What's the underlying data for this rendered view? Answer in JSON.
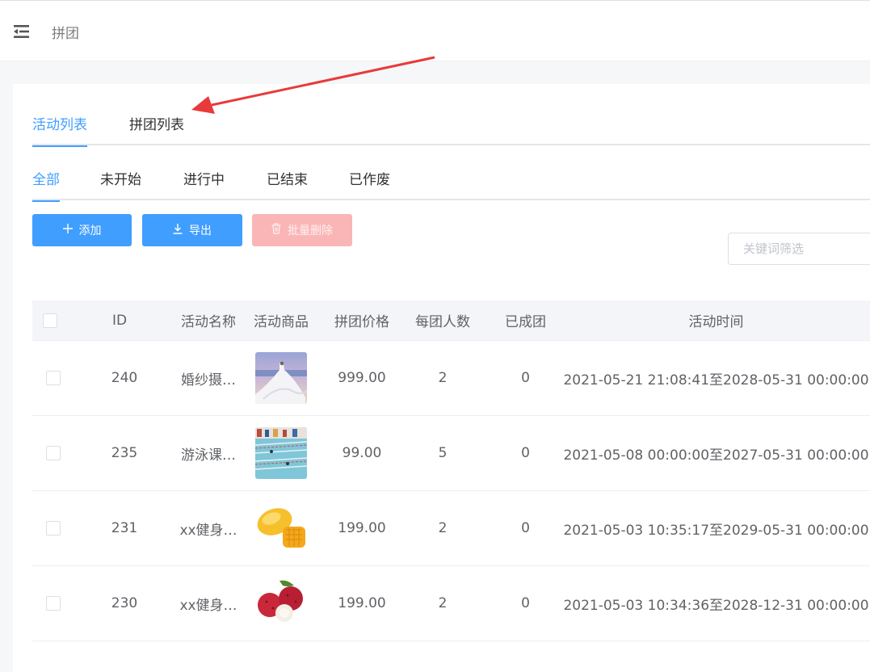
{
  "header": {
    "breadcrumb": "拼团",
    "menu_icon": "menu-fold-icon"
  },
  "tabs_main": [
    {
      "label": "活动列表",
      "active": true
    },
    {
      "label": "拼团列表",
      "active": false
    }
  ],
  "tabs_status": [
    {
      "label": "全部",
      "active": true
    },
    {
      "label": "未开始",
      "active": false
    },
    {
      "label": "进行中",
      "active": false
    },
    {
      "label": "已结束",
      "active": false
    },
    {
      "label": "已作废",
      "active": false
    }
  ],
  "toolbar": {
    "add_label": "添加",
    "add_icon": "plus-icon",
    "export_label": "导出",
    "export_icon": "download-icon",
    "batch_delete_label": "批量删除",
    "batch_delete_icon": "trash-icon",
    "search_placeholder": "关键词筛选",
    "search_value": ""
  },
  "table": {
    "columns": [
      "ID",
      "活动名称",
      "活动商品",
      "拼团价格",
      "每团人数",
      "已成团",
      "活动时间"
    ],
    "rows": [
      {
        "id": "240",
        "name": "婚纱摄…",
        "product_image": "wedding-photo",
        "price": "999.00",
        "members": "2",
        "completed": "0",
        "time": "2021-05-21 21:08:41至2028-05-31 00:00:00"
      },
      {
        "id": "235",
        "name": "游泳课…",
        "product_image": "swimming-pool",
        "price": "99.00",
        "members": "5",
        "completed": "0",
        "time": "2021-05-08 00:00:00至2027-05-31 00:00:00"
      },
      {
        "id": "231",
        "name": "xx健身…",
        "product_image": "mango",
        "price": "199.00",
        "members": "2",
        "completed": "0",
        "time": "2021-05-03 10:35:17至2029-05-31 00:00:00"
      },
      {
        "id": "230",
        "name": "xx健身…",
        "product_image": "lychee",
        "price": "199.00",
        "members": "2",
        "completed": "0",
        "time": "2021-05-03 10:34:36至2028-12-31 00:00:00"
      }
    ]
  },
  "colors": {
    "primary": "#409eff",
    "danger_disabled": "#fab6b6",
    "annotation_arrow": "#e83a3a"
  }
}
